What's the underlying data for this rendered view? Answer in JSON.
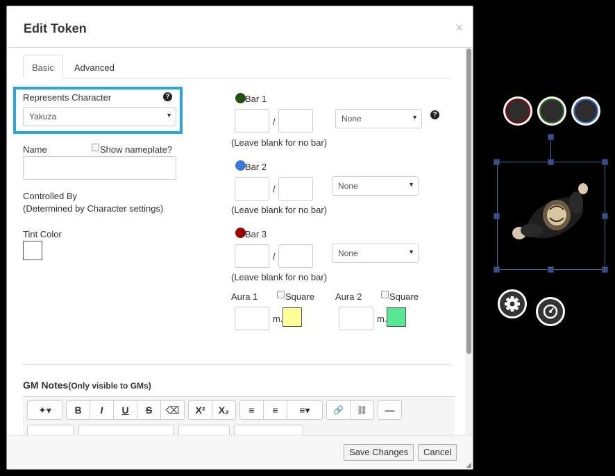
{
  "dialog": {
    "title": "Edit Token",
    "close_glyph": "×",
    "tabs": [
      {
        "label": "Basic",
        "active": true
      },
      {
        "label": "Advanced",
        "active": false
      }
    ]
  },
  "basic": {
    "represents": {
      "label": "Represents Character",
      "help": "?",
      "value": "Yakuza"
    },
    "name": {
      "label": "Name",
      "value": "",
      "show_nameplate_label": "Show nameplate?",
      "show_nameplate_checked": false
    },
    "controlled_by": {
      "label": "Controlled By",
      "note": "(Determined by Character settings)"
    },
    "tint": {
      "label": "Tint Color",
      "color": "#ffffff"
    }
  },
  "bars": [
    {
      "label": "Bar 1",
      "color": "#274e13",
      "value": "",
      "max": "",
      "link": "None",
      "hint": "(Leave blank for no bar)",
      "help": "?"
    },
    {
      "label": "Bar 2",
      "color": "#3c78d8",
      "value": "",
      "max": "",
      "link": "None",
      "hint": "(Leave blank for no bar)"
    },
    {
      "label": "Bar 3",
      "color": "#990000",
      "value": "",
      "max": "",
      "link": "None",
      "hint": "(Leave blank for no bar)"
    }
  ],
  "bar_separator": "/",
  "auras": [
    {
      "label": "Aura 1",
      "square_label": "Square",
      "unit": "m.",
      "radius": "",
      "color": "#ffff99"
    },
    {
      "label": "Aura 2",
      "square_label": "Square",
      "unit": "m.",
      "radius": "",
      "color": "#59e594"
    }
  ],
  "gm_notes": {
    "label": "GM Notes",
    "sub": "(Only visible to GMs)"
  },
  "toolbar": {
    "row1": [
      {
        "icon": "magic-wand-icon",
        "glyph": "✦▾"
      },
      {
        "icon": "bold-icon",
        "glyph": "B"
      },
      {
        "icon": "italic-icon",
        "glyph": "I"
      },
      {
        "icon": "underline-icon",
        "glyph": "U"
      },
      {
        "icon": "strikethrough-icon",
        "glyph": "S"
      },
      {
        "icon": "eraser-icon",
        "glyph": "⌫"
      },
      {
        "icon": "superscript-icon",
        "glyph": "X²"
      },
      {
        "icon": "subscript-icon",
        "glyph": "X₂"
      },
      {
        "icon": "ordered-list-icon",
        "glyph": "≡"
      },
      {
        "icon": "unordered-list-icon",
        "glyph": "≡"
      },
      {
        "icon": "align-icon",
        "glyph": "≡▾"
      },
      {
        "icon": "link-icon",
        "glyph": "🔗"
      },
      {
        "icon": "unlink-icon",
        "glyph": "⛓"
      },
      {
        "icon": "horizontal-rule-icon",
        "glyph": "—"
      }
    ]
  },
  "footer": {
    "save": "Save Changes",
    "cancel": "Cancel"
  },
  "token": {
    "status_rings": [
      "#8b0000",
      "#2e6b1e",
      "#3c78d8"
    ],
    "settings_icon": "gear-icon",
    "quick_menu_icon": "gauge-icon"
  }
}
